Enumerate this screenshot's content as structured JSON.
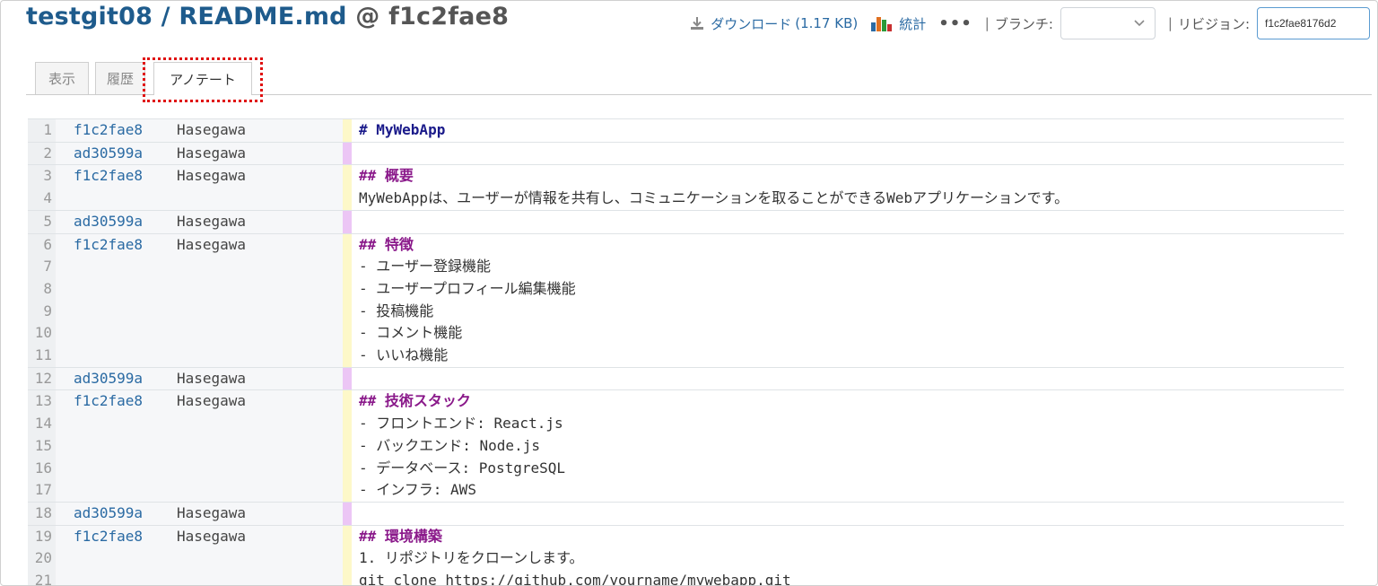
{
  "header": {
    "repo": "testgit08",
    "slash": " / ",
    "file": "README.md",
    "at": " @ ",
    "revision": "f1c2fae8"
  },
  "toolbar": {
    "download_label": "ダウンロード",
    "download_size": "(1.17 KB)",
    "stats_label": "統計",
    "more_label": "•••",
    "separator": "|",
    "branch_label": "ブランチ:",
    "branch_value": "",
    "revision_label": "リビジョン:",
    "revision_value": "f1c2fae8176d2"
  },
  "tabs": [
    {
      "label": "表示",
      "active": false
    },
    {
      "label": "履歴",
      "active": false
    },
    {
      "label": "アノテート",
      "active": true
    }
  ],
  "colors": {
    "highlight_box": "#e01010",
    "author_bar": "#fdf8c9",
    "blank_bar": "#ecc6f5",
    "heading1": "#1a1a8a",
    "heading2": "#8a198a",
    "link": "#2a6aa3"
  },
  "annotate": {
    "lines": [
      {
        "n": "1",
        "rev": "f1c2fae8",
        "author": "Hasegawa",
        "code": "# MyWebApp",
        "style": "h1",
        "bar": "yellow",
        "start": true
      },
      {
        "n": "2",
        "rev": "ad30599a",
        "author": "Hasegawa",
        "code": "",
        "style": "",
        "bar": "purple",
        "start": true
      },
      {
        "n": "3",
        "rev": "f1c2fae8",
        "author": "Hasegawa",
        "code": "## 概要",
        "style": "h2",
        "bar": "yellow",
        "start": true
      },
      {
        "n": "4",
        "rev": "",
        "author": "",
        "code": "MyWebAppは、ユーザーが情報を共有し、コミュニケーションを取ることができるWebアプリケーションです。",
        "style": "",
        "bar": "yellow",
        "start": false
      },
      {
        "n": "5",
        "rev": "ad30599a",
        "author": "Hasegawa",
        "code": "",
        "style": "",
        "bar": "purple",
        "start": true
      },
      {
        "n": "6",
        "rev": "f1c2fae8",
        "author": "Hasegawa",
        "code": "## 特徴",
        "style": "h2",
        "bar": "yellow",
        "start": true
      },
      {
        "n": "7",
        "rev": "",
        "author": "",
        "code": "- ユーザー登録機能",
        "style": "",
        "bar": "yellow",
        "start": false
      },
      {
        "n": "8",
        "rev": "",
        "author": "",
        "code": "- ユーザープロフィール編集機能",
        "style": "",
        "bar": "yellow",
        "start": false
      },
      {
        "n": "9",
        "rev": "",
        "author": "",
        "code": "- 投稿機能",
        "style": "",
        "bar": "yellow",
        "start": false
      },
      {
        "n": "10",
        "rev": "",
        "author": "",
        "code": "- コメント機能",
        "style": "",
        "bar": "yellow",
        "start": false
      },
      {
        "n": "11",
        "rev": "",
        "author": "",
        "code": "- いいね機能",
        "style": "",
        "bar": "yellow",
        "start": false
      },
      {
        "n": "12",
        "rev": "ad30599a",
        "author": "Hasegawa",
        "code": "",
        "style": "",
        "bar": "purple",
        "start": true
      },
      {
        "n": "13",
        "rev": "f1c2fae8",
        "author": "Hasegawa",
        "code": "## 技術スタック",
        "style": "h2",
        "bar": "yellow",
        "start": true
      },
      {
        "n": "14",
        "rev": "",
        "author": "",
        "code": "- フロントエンド: React.js",
        "style": "",
        "bar": "yellow",
        "start": false
      },
      {
        "n": "15",
        "rev": "",
        "author": "",
        "code": "- バックエンド: Node.js",
        "style": "",
        "bar": "yellow",
        "start": false
      },
      {
        "n": "16",
        "rev": "",
        "author": "",
        "code": "- データベース: PostgreSQL",
        "style": "",
        "bar": "yellow",
        "start": false
      },
      {
        "n": "17",
        "rev": "",
        "author": "",
        "code": "- インフラ: AWS",
        "style": "",
        "bar": "yellow",
        "start": false
      },
      {
        "n": "18",
        "rev": "ad30599a",
        "author": "Hasegawa",
        "code": "",
        "style": "",
        "bar": "purple",
        "start": true
      },
      {
        "n": "19",
        "rev": "f1c2fae8",
        "author": "Hasegawa",
        "code": "## 環境構築",
        "style": "h2",
        "bar": "yellow",
        "start": true
      },
      {
        "n": "20",
        "rev": "",
        "author": "",
        "code": "1. リポジトリをクローンします。",
        "style": "",
        "bar": "yellow",
        "start": false
      },
      {
        "n": "21",
        "rev": "",
        "author": "",
        "code": "git clone https://github.com/yourname/mywebapp.git",
        "style": "",
        "bar": "yellow",
        "start": false
      }
    ]
  }
}
